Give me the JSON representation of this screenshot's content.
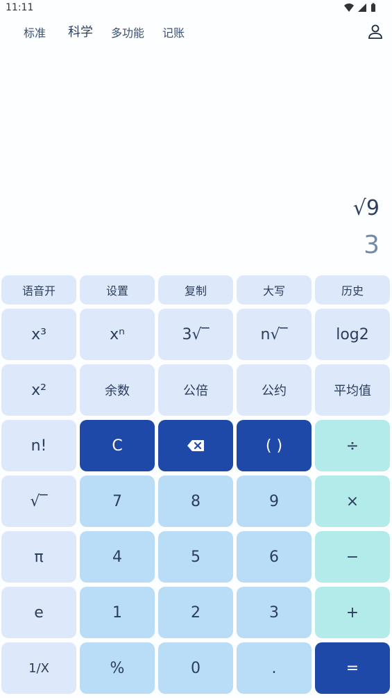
{
  "status": {
    "time": "11:11"
  },
  "tabs": [
    "标准",
    "科学",
    "多功能",
    "记账"
  ],
  "display": {
    "expression": "√9",
    "result": "3"
  },
  "topRow": [
    "语音开",
    "设置",
    "复制",
    "大写",
    "历史"
  ],
  "row1": [
    "x³",
    "xⁿ",
    "3√‾",
    "n√‾",
    "log2"
  ],
  "row2": [
    "x²",
    "余数",
    "公倍",
    "公约",
    "平均值"
  ],
  "row3": [
    "n!",
    "C",
    "",
    "( )",
    "÷"
  ],
  "row4": [
    "√‾",
    "7",
    "8",
    "9",
    "×"
  ],
  "row5": [
    "π",
    "4",
    "5",
    "6",
    "−"
  ],
  "row6": [
    "e",
    "1",
    "2",
    "3",
    "+"
  ],
  "row7": [
    "1/X",
    "%",
    "0",
    ".",
    "="
  ],
  "colors": {
    "light": "#dde8fa",
    "number": "#b9ddf6",
    "dark": "#1f49a8",
    "operator": "#b3eaea"
  }
}
